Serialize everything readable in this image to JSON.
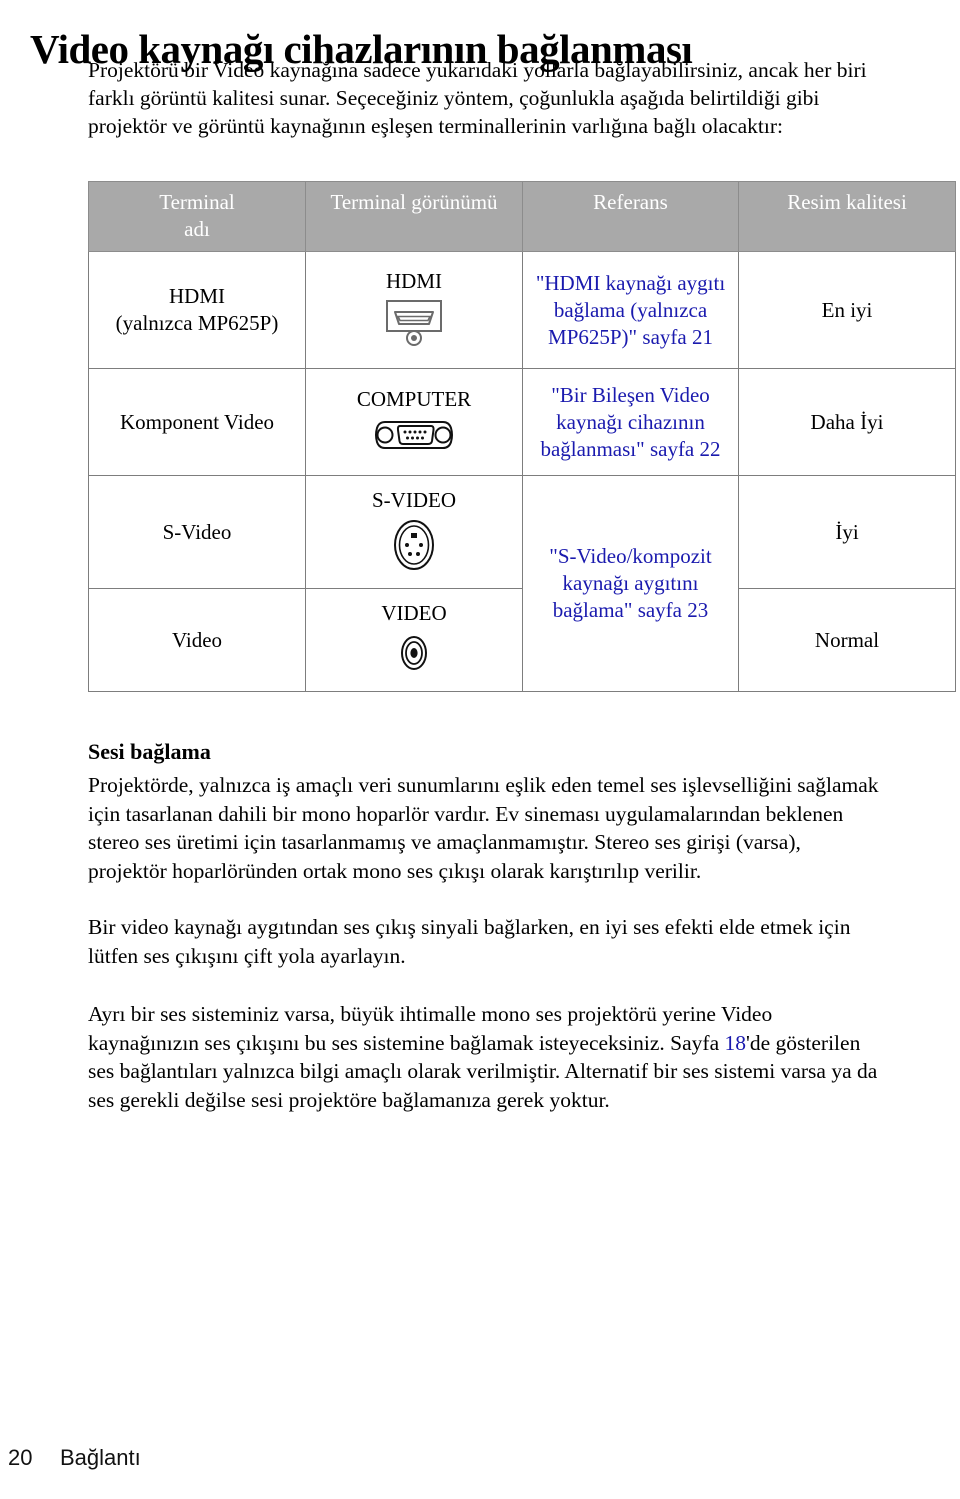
{
  "page": {
    "title": "Video kaynağı cihazlarının bağlanması",
    "intro_lines": [
      "Projektörü bir Video kaynağına sadece yukarıdaki yollarla bağlayabilirsiniz, ancak her biri",
      "farklı görüntü kalitesi sunar. Seçeceğiniz yöntem, çoğunlukla aşağıda belirtildiği gibi",
      "projektör ve görüntü kaynağının eşleşen terminallerinin varlığına bağlı olacaktır:"
    ]
  },
  "table": {
    "headers": [
      {
        "line1": "Terminal",
        "line2": "adı"
      },
      {
        "line1": "Terminal görünümü",
        "line2": ""
      },
      {
        "line1": "Referans",
        "line2": ""
      },
      {
        "line1": "Resim kalitesi",
        "line2": ""
      }
    ],
    "rows": [
      {
        "name_line1": "HDMI",
        "name_line2": "(yalnızca MP625P)",
        "view_label": "HDMI",
        "view_icon": "hdmi-connector-icon",
        "ref_lines": [
          "\"HDMI kaynağı",
          "aygıtı bağlama",
          "(yalnızca MP625P)\"",
          "sayfa 21"
        ],
        "quality": "En iyi"
      },
      {
        "name_line1": "Komponent Video",
        "name_line2": "",
        "view_label": "COMPUTER",
        "view_icon": "dsub-vga-connector-icon",
        "ref_lines": [
          "\"Bir Bileşen Video",
          "kaynağı cihazının",
          "bağlanması\" sayfa 22"
        ],
        "quality": "Daha İyi"
      },
      {
        "name_line1": "S-Video",
        "name_line2": "",
        "view_label": "S-VIDEO",
        "view_icon": "s-video-minidin-connector-icon",
        "ref_lines": [
          "\"S-Video/kompozit",
          "kaynağı aygıtını",
          "bağlama\" sayfa 23"
        ],
        "quality": "İyi"
      },
      {
        "name_line1": "Video",
        "name_line2": "",
        "view_label": "VIDEO",
        "view_icon": "rca-composite-jack-icon",
        "ref_lines": [],
        "quality": "Normal"
      }
    ]
  },
  "audio_section": {
    "heading": "Sesi bağlama",
    "para1_lines": [
      "Projektörde, yalnızca iş amaçlı veri sunumlarını eşlik eden temel ses işlevselliğini sağlamak",
      "için tasarlanan dahili bir mono hoparlör vardır. Ev sineması uygulamalarından beklenen",
      "stereo ses üretimi için tasarlanmamış ve amaçlanmamıştır. Stereo ses girişi (varsa),",
      "projektör hoparlöründen ortak mono ses çıkışı olarak karıştırılıp verilir."
    ],
    "para2_lines": [
      "Bir video kaynağı aygıtından ses çıkış sinyali bağlarken, en iyi ses efekti elde etmek için",
      "lütfen ses çıkışını çift yola ayarlayın."
    ],
    "para3": {
      "line1": "Ayrı bir ses sisteminiz varsa, büyük ihtimalle mono ses projektörü yerine Video",
      "line2_before": "kaynağınızın ses çıkışını bu ses sistemine bağlamak isteyeceksiniz. Sayfa ",
      "line2_link": "18",
      "line2_after": "'de gösterilen",
      "line3": "ses bağlantıları yalnızca bilgi amaçlı olarak verilmiştir. Alternatif bir ses sistemi varsa ya da",
      "line4": "ses gerekli değilse sesi projektöre bağlamanıza gerek yoktur."
    }
  },
  "footer": {
    "page_number": "20",
    "chapter": "Bağlantı"
  },
  "colors": {
    "header_background": "#a9a9a9",
    "header_text": "#ffffff",
    "reference_link": "#1a1aae",
    "body_text": "#000000",
    "table_border": "#7d7d7d"
  }
}
